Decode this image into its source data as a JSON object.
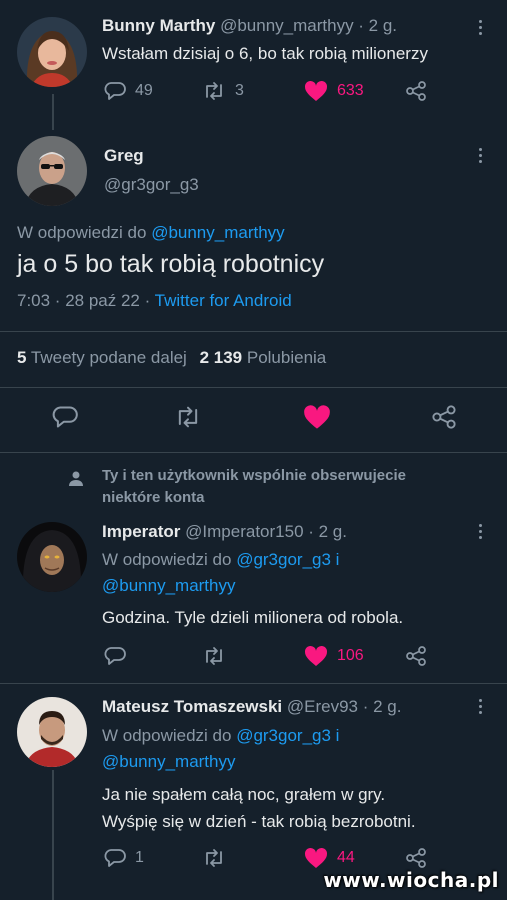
{
  "tweet1": {
    "name": "Bunny Marthy",
    "handle_time": "@bunny_marthyy · 2 g.",
    "text": "Wstałam dzisiaj o 6, bo tak robią milionerzy",
    "replies": "49",
    "retweets": "3",
    "likes": "633"
  },
  "main_tweet": {
    "name": "Greg",
    "handle": "@gr3gor_g3",
    "reply_prefix": "W odpowiedzi do ",
    "reply_to": "@bunny_marthyy",
    "text": "ja o 5 bo tak robią robotnicy",
    "time": "7:03 · 28 paź 22 · ",
    "client": "Twitter for Android",
    "retweet_count": "5",
    "retweet_label": "Tweety podane dalej",
    "like_count": "2 139",
    "like_label": "Polubienia"
  },
  "follow_context": {
    "line1": "Ty i ten użytkownik wspólnie obserwujecie",
    "line2": "niektóre konta"
  },
  "reply1": {
    "name": "Imperator",
    "handle_time": "@Imperator150 · 2 g.",
    "reply_prefix": "W odpowiedzi do ",
    "reply_to_1": "@gr3gor_g3",
    "reply_joiner": " i",
    "reply_to_2": "@bunny_marthyy",
    "text": "Godzina. Tyle dzieli milionera od robola.",
    "replies": "",
    "retweets": "",
    "likes": "106"
  },
  "reply2": {
    "name": "Mateusz Tomaszewski",
    "handle_time": "@Erev93 · 2 g.",
    "reply_prefix": "W odpowiedzi do ",
    "reply_to_1": "@gr3gor_g3",
    "reply_joiner": " i",
    "reply_to_2": "@bunny_marthyy",
    "text_line1": "Ja nie spałem całą noc, grałem w gry.",
    "text_line2": "Wyśpię się w dzień - tak robią bezrobotni.",
    "replies": "1",
    "retweets": "",
    "likes": "44"
  },
  "watermark": "www.wiocha.pl",
  "colors": {
    "background": "#15202b",
    "text": "#e7e9ea",
    "muted": "#8b98a5",
    "link": "#1d9bf0",
    "like": "#f91880",
    "divider": "#38444d"
  },
  "icons": [
    "reply-icon",
    "retweet-icon",
    "heart-icon",
    "share-icon",
    "more-icon",
    "person-icon"
  ]
}
